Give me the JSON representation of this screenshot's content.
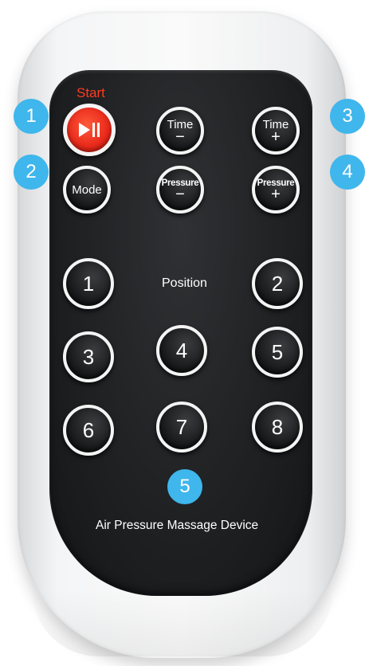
{
  "remote": {
    "start_label": "Start",
    "top_row": {
      "time_minus": {
        "label": "Time",
        "sign": "−"
      },
      "time_plus": {
        "label": "Time",
        "sign": "+"
      }
    },
    "second_row": {
      "mode": "Mode",
      "pressure_minus": {
        "label": "Pressure",
        "sign": "−"
      },
      "pressure_plus": {
        "label": "Pressure",
        "sign": "+"
      }
    },
    "position_label": "Position",
    "position_buttons": [
      "1",
      "2",
      "3",
      "4",
      "5",
      "6",
      "7",
      "8"
    ],
    "device_label": "Air Pressure Massage Device"
  },
  "badges": [
    "1",
    "2",
    "3",
    "4",
    "5"
  ],
  "colors": {
    "badge": "#3fb6ec",
    "start": "#e8281a",
    "panel": "#1f2123",
    "shell": "#f4f5f6"
  },
  "icons": {
    "start": "play-pause-icon"
  }
}
